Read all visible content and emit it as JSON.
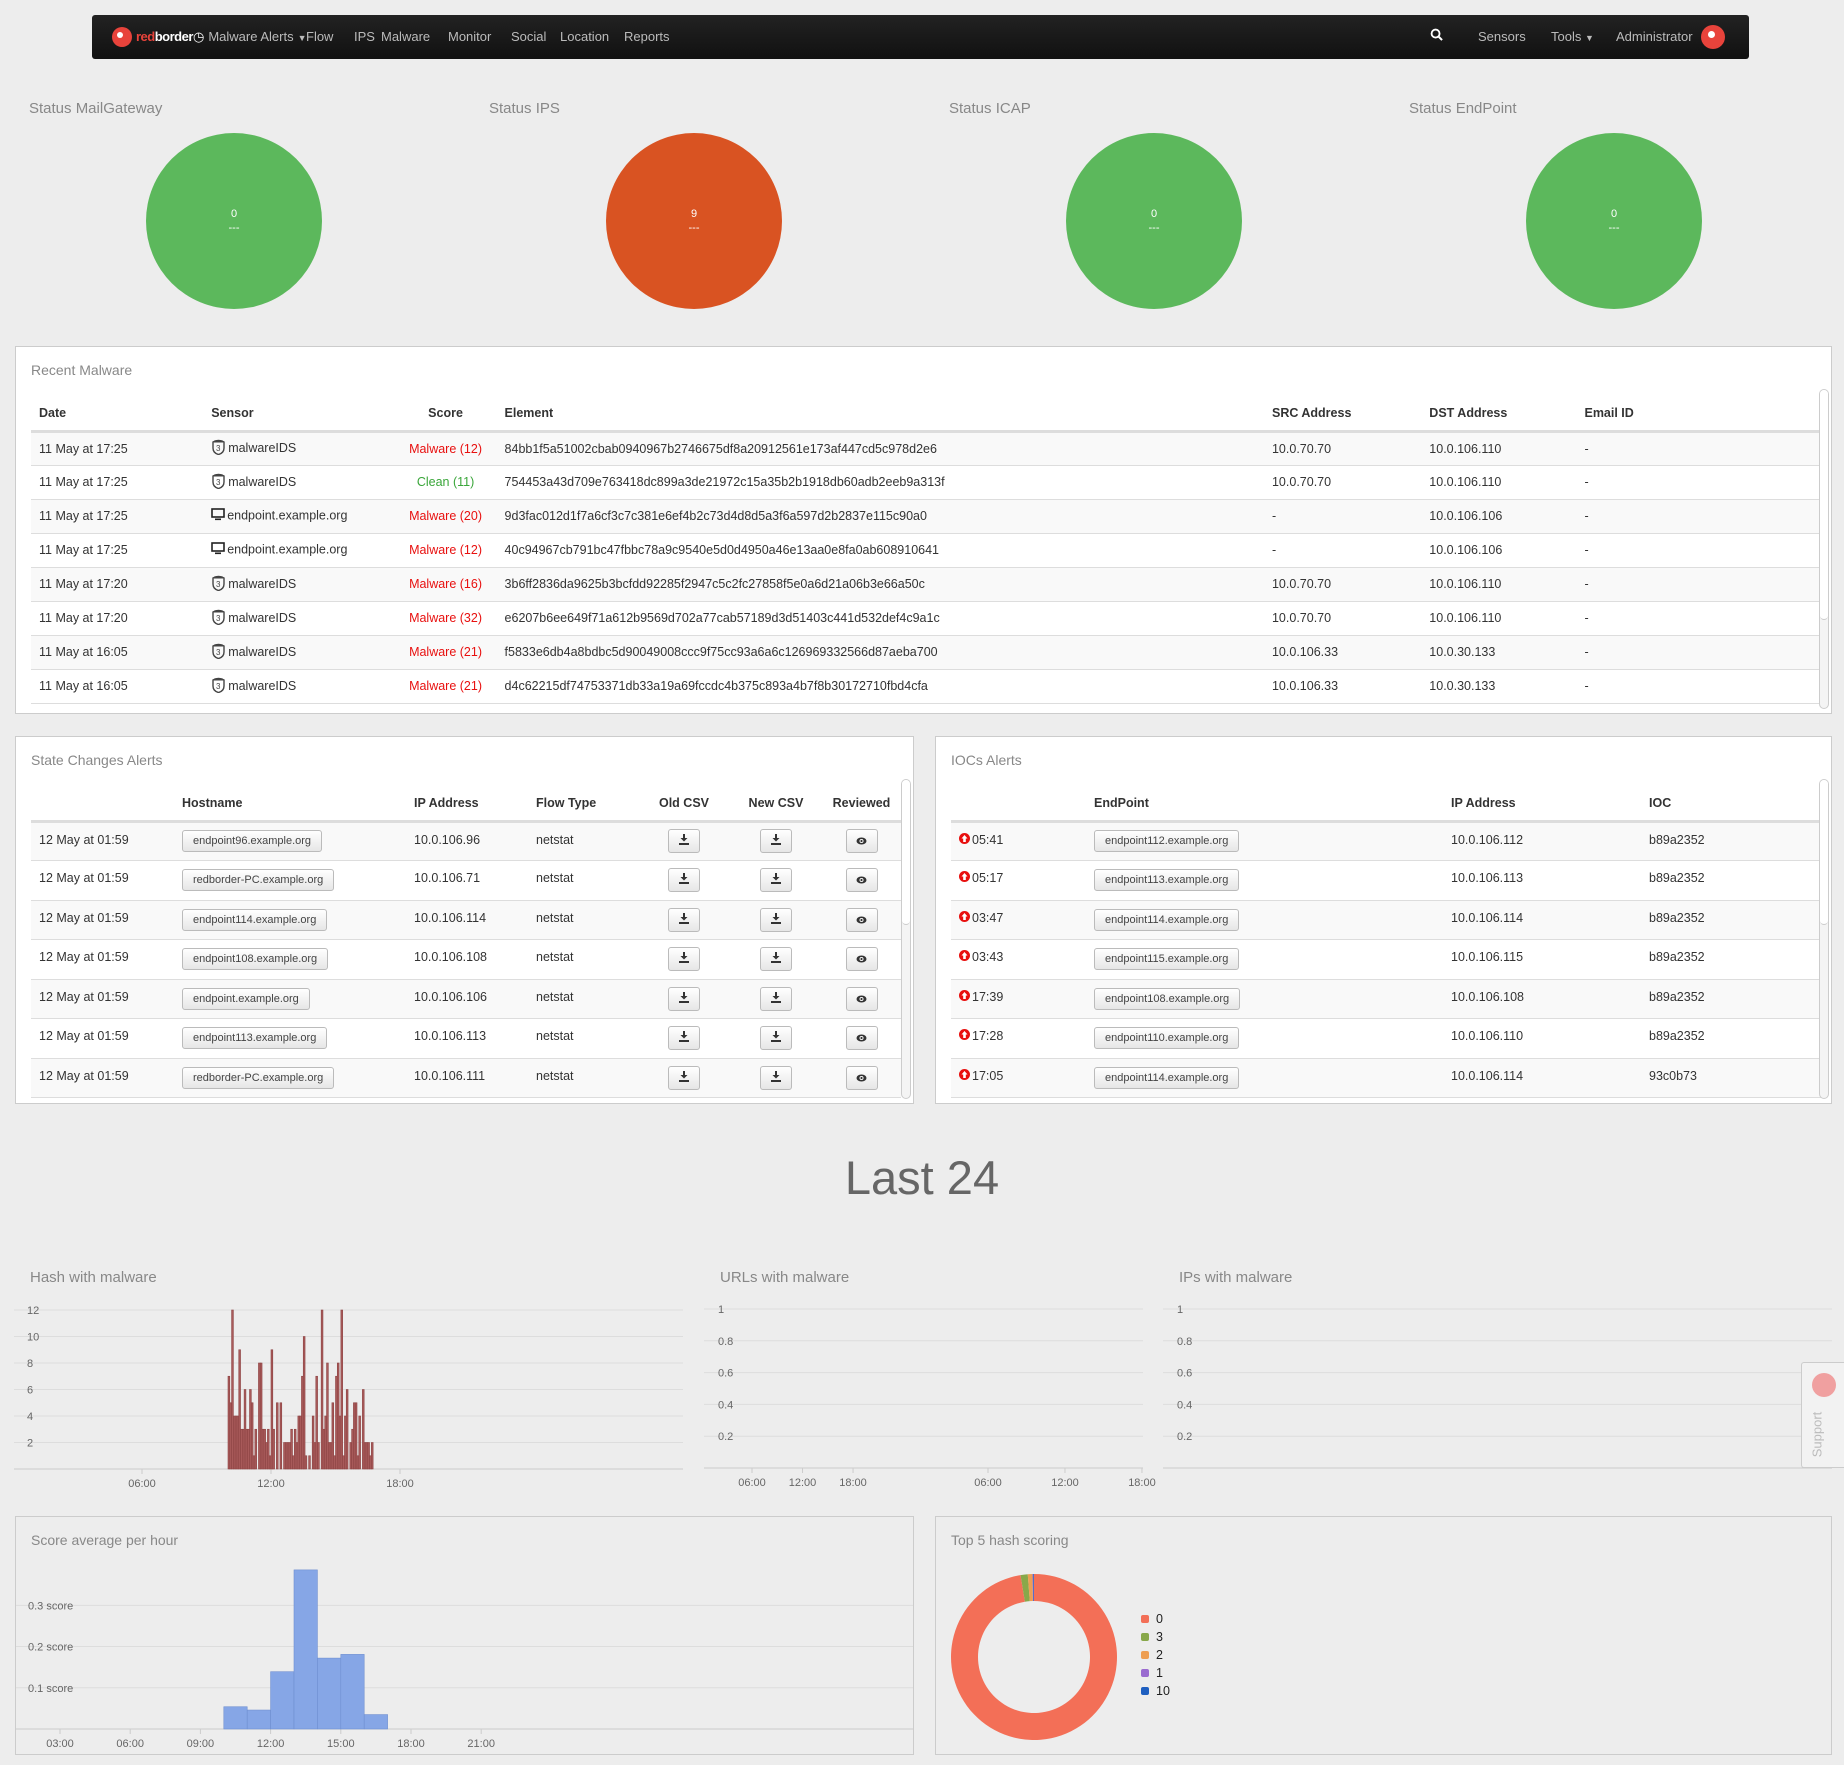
{
  "nav": {
    "brand": "redborder",
    "items": [
      {
        "label": "Malware Alerts",
        "icon": "clock-icon",
        "dropdown": true
      },
      {
        "label": "Flow"
      },
      {
        "label": "IPS"
      },
      {
        "label": "Malware"
      },
      {
        "label": "Monitor"
      },
      {
        "label": "Social"
      },
      {
        "label": "Location"
      },
      {
        "label": "Reports"
      }
    ],
    "right": {
      "search_icon": "search-icon",
      "sensors": "Sensors",
      "tools": "Tools",
      "user": "Administrator"
    }
  },
  "status": [
    {
      "title": "Status MailGateway",
      "value": "0",
      "sub": "---",
      "color": "#5cb85c"
    },
    {
      "title": "Status IPS",
      "value": "9",
      "sub": "---",
      "color": "#d95322"
    },
    {
      "title": "Status ICAP",
      "value": "0",
      "sub": "---",
      "color": "#5cb85c"
    },
    {
      "title": "Status EndPoint",
      "value": "0",
      "sub": "---",
      "color": "#5cb85c"
    }
  ],
  "recent_malware": {
    "title": "Recent Malware",
    "columns": [
      "Date",
      "Sensor",
      "Score",
      "Element",
      "SRC Address",
      "DST Address",
      "Email ID"
    ],
    "rows": [
      {
        "date": "11 May at 17:25",
        "sensor_icon": "ids",
        "sensor": "malwareIDS",
        "score": "Malware (12)",
        "status": "malware",
        "element": "84bb1f5a51002cbab0940967b2746675df8a20912561e173af447cd5c978d2e6",
        "src": "10.0.70.70",
        "dst": "10.0.106.110",
        "email": "-"
      },
      {
        "date": "11 May at 17:25",
        "sensor_icon": "ids",
        "sensor": "malwareIDS",
        "score": "Clean (11)",
        "status": "clean",
        "element": "754453a43d709e763418dc899a3de21972c15a35b2b1918db60adb2eeb9a313f",
        "src": "10.0.70.70",
        "dst": "10.0.106.110",
        "email": "-"
      },
      {
        "date": "11 May at 17:25",
        "sensor_icon": "monitor",
        "sensor": "endpoint.example.org",
        "score": "Malware (20)",
        "status": "malware",
        "element": "9d3fac012d1f7a6cf3c7c381e6ef4b2c73d4d8d5a3f6a597d2b2837e115c90a0",
        "src": "-",
        "dst": "10.0.106.106",
        "email": "-"
      },
      {
        "date": "11 May at 17:25",
        "sensor_icon": "monitor",
        "sensor": "endpoint.example.org",
        "score": "Malware (12)",
        "status": "malware",
        "element": "40c94967cb791bc47fbbc78a9c9540e5d0d4950a46e13aa0e8fa0ab608910641",
        "src": "-",
        "dst": "10.0.106.106",
        "email": "-"
      },
      {
        "date": "11 May at 17:20",
        "sensor_icon": "ids",
        "sensor": "malwareIDS",
        "score": "Malware (16)",
        "status": "malware",
        "element": "3b6ff2836da9625b3bcfdd92285f2947c5c2fc27858f5e0a6d21a06b3e66a50c",
        "src": "10.0.70.70",
        "dst": "10.0.106.110",
        "email": "-"
      },
      {
        "date": "11 May at 17:20",
        "sensor_icon": "ids",
        "sensor": "malwareIDS",
        "score": "Malware (32)",
        "status": "malware",
        "element": "e6207b6ee649f71a612b9569d702a77cab57189d3d51403c441d532def4c9a1c",
        "src": "10.0.70.70",
        "dst": "10.0.106.110",
        "email": "-"
      },
      {
        "date": "11 May at 16:05",
        "sensor_icon": "ids",
        "sensor": "malwareIDS",
        "score": "Malware (21)",
        "status": "malware",
        "element": "f5833e6db4a8bdbc5d90049008ccc9f75cc93a6a6c126969332566d87aeba700",
        "src": "10.0.106.33",
        "dst": "10.0.30.133",
        "email": "-"
      },
      {
        "date": "11 May at 16:05",
        "sensor_icon": "ids",
        "sensor": "malwareIDS",
        "score": "Malware (21)",
        "status": "malware",
        "element": "d4c62215df74753371db33a19a69fccdc4b375c893a4b7f8b30172710fbd4cfa",
        "src": "10.0.106.33",
        "dst": "10.0.30.133",
        "email": "-"
      }
    ]
  },
  "state_changes": {
    "title": "State Changes Alerts",
    "columns": [
      "",
      "Hostname",
      "IP Address",
      "Flow Type",
      "Old CSV",
      "New CSV",
      "Reviewed"
    ],
    "rows": [
      {
        "date": "12 May at 01:59",
        "host": "endpoint96.example.org",
        "ip": "10.0.106.96",
        "flow": "netstat"
      },
      {
        "date": "12 May at 01:59",
        "host": "redborder-PC.example.org",
        "ip": "10.0.106.71",
        "flow": "netstat"
      },
      {
        "date": "12 May at 01:59",
        "host": "endpoint114.example.org",
        "ip": "10.0.106.114",
        "flow": "netstat"
      },
      {
        "date": "12 May at 01:59",
        "host": "endpoint108.example.org",
        "ip": "10.0.106.108",
        "flow": "netstat"
      },
      {
        "date": "12 May at 01:59",
        "host": "endpoint.example.org",
        "ip": "10.0.106.106",
        "flow": "netstat"
      },
      {
        "date": "12 May at 01:59",
        "host": "endpoint113.example.org",
        "ip": "10.0.106.113",
        "flow": "netstat"
      },
      {
        "date": "12 May at 01:59",
        "host": "redborder-PC.example.org",
        "ip": "10.0.106.111",
        "flow": "netstat"
      }
    ]
  },
  "iocs": {
    "title": "IOCs Alerts",
    "columns": [
      "",
      "EndPoint",
      "IP Address",
      "IOC"
    ],
    "rows": [
      {
        "time": "05:41",
        "endpoint": "endpoint112.example.org",
        "ip": "10.0.106.112",
        "ioc": "b89a2352"
      },
      {
        "time": "05:17",
        "endpoint": "endpoint113.example.org",
        "ip": "10.0.106.113",
        "ioc": "b89a2352"
      },
      {
        "time": "03:47",
        "endpoint": "endpoint114.example.org",
        "ip": "10.0.106.114",
        "ioc": "b89a2352"
      },
      {
        "time": "03:43",
        "endpoint": "endpoint115.example.org",
        "ip": "10.0.106.115",
        "ioc": "b89a2352"
      },
      {
        "time": "17:39",
        "endpoint": "endpoint108.example.org",
        "ip": "10.0.106.108",
        "ioc": "b89a2352"
      },
      {
        "time": "17:28",
        "endpoint": "endpoint110.example.org",
        "ip": "10.0.106.110",
        "ioc": "b89a2352"
      },
      {
        "time": "17:05",
        "endpoint": "endpoint114.example.org",
        "ip": "10.0.106.114",
        "ioc": "93c0b73"
      }
    ]
  },
  "section_title": "Last 24",
  "support": "Support",
  "chart_data": [
    {
      "id": "hash",
      "type": "bar",
      "title": "Hash with malware",
      "color": "#a85a5a",
      "grid": true,
      "xlim_hours": [
        0,
        31
      ],
      "xticks": [
        "06:00",
        "12:00",
        "18:00"
      ],
      "ylim": [
        0,
        12
      ],
      "yticks": [
        2,
        4,
        6,
        8,
        10,
        12
      ],
      "x": [
        "10:00",
        "10:05",
        "10:10",
        "10:15",
        "10:20",
        "10:25",
        "10:30",
        "10:35",
        "10:40",
        "10:45",
        "10:50",
        "10:55",
        "11:00",
        "11:05",
        "11:10",
        "11:15",
        "11:20",
        "11:25",
        "11:30",
        "11:35",
        "11:40",
        "11:45",
        "11:50",
        "11:55",
        "12:00",
        "12:05",
        "12:10",
        "12:15",
        "12:20",
        "12:25",
        "12:30",
        "12:35",
        "12:40",
        "12:45",
        "12:50",
        "12:55",
        "13:00",
        "13:05",
        "13:10",
        "13:15",
        "13:20",
        "13:25",
        "13:30",
        "13:35",
        "13:40",
        "13:45",
        "13:50",
        "13:55",
        "14:00",
        "14:05",
        "14:10",
        "14:15",
        "14:20",
        "14:25",
        "14:30",
        "14:35",
        "14:40",
        "14:45",
        "14:50",
        "14:55",
        "15:00",
        "15:05",
        "15:10",
        "15:15",
        "15:20",
        "15:25",
        "15:30",
        "15:35",
        "15:40",
        "15:45",
        "15:50",
        "15:55",
        "16:00",
        "16:05",
        "16:10",
        "16:15",
        "16:20",
        "16:25",
        "16:30",
        "16:35",
        "16:40"
      ],
      "values": [
        7,
        5,
        12,
        4,
        4,
        4,
        9,
        3,
        3,
        6,
        3,
        3,
        6,
        5,
        1,
        3,
        0,
        8,
        8,
        3,
        3,
        2,
        3,
        1,
        9,
        3,
        0,
        5,
        0,
        5,
        0,
        2,
        2,
        2,
        2,
        3,
        1,
        3,
        2,
        4,
        4,
        7,
        10,
        1,
        0,
        1,
        0,
        4,
        2,
        7,
        2,
        0,
        12,
        3,
        4,
        8,
        2,
        2,
        5,
        1,
        7,
        8,
        4,
        12,
        1,
        4,
        6,
        0,
        2,
        3,
        5,
        5,
        1,
        4,
        0,
        6,
        2,
        2,
        2,
        1,
        2
      ]
    },
    {
      "id": "urls",
      "type": "bar",
      "title": "URLs with malware",
      "grid": true,
      "xticks": [
        "06:00",
        "12:00",
        "18:00"
      ],
      "ylim": [
        0,
        1
      ],
      "yticks": [
        "0.2",
        "0.4",
        "0.6",
        "0.8",
        "1"
      ],
      "values": []
    },
    {
      "id": "ips",
      "type": "bar",
      "title": "IPs with malware",
      "grid": true,
      "xticks": [
        "06:00",
        "12:00",
        "18:00"
      ],
      "ylim": [
        0,
        1
      ],
      "yticks": [
        "0.2",
        "0.4",
        "0.6",
        "0.8",
        "1"
      ],
      "values": []
    },
    {
      "id": "score",
      "type": "bar",
      "title": "Score average per hour",
      "color": "#86a6e6",
      "grid": true,
      "xlim_hours": [
        1,
        23
      ],
      "xticks": [
        "03:00",
        "06:00",
        "09:00",
        "12:00",
        "15:00",
        "18:00",
        "21:00"
      ],
      "ylim": [
        0,
        0.41
      ],
      "yticks": [
        "0.1 score",
        "0.2 score",
        "0.3 score"
      ],
      "x": [
        "10:00",
        "11:00",
        "12:00",
        "13:00",
        "14:00",
        "15:00",
        "16:00"
      ],
      "values": [
        0.054,
        0.046,
        0.139,
        0.386,
        0.172,
        0.181,
        0.035
      ]
    },
    {
      "id": "top5",
      "type": "pie",
      "title": "Top 5 hash scoring",
      "legend": "right",
      "labels": [
        "0",
        "3",
        "2",
        "1",
        "10"
      ],
      "values": [
        97.4,
        1.4,
        0.9,
        0.15,
        0.15
      ],
      "colors": [
        "#f36f57",
        "#88a84a",
        "#ee9e52",
        "#9a6bd0",
        "#1f5fc0"
      ]
    }
  ]
}
